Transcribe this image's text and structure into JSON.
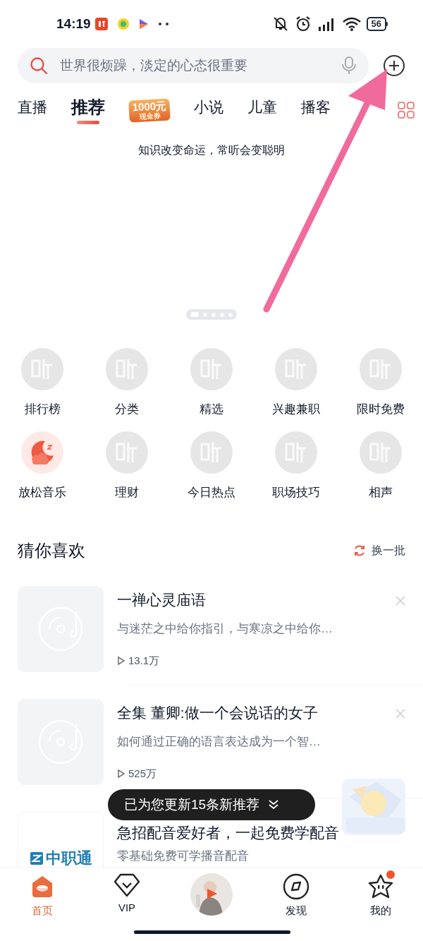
{
  "status_bar": {
    "time": "14:19",
    "battery": "56"
  },
  "search": {
    "placeholder": "世界很烦躁，淡定的心态很重要"
  },
  "tabs": [
    {
      "kind": "text",
      "label": "直播",
      "selected": false
    },
    {
      "kind": "text",
      "label": "推荐",
      "selected": true
    },
    {
      "kind": "coupon",
      "label": "1000元",
      "sublabel": "现金券",
      "selected": false
    },
    {
      "kind": "text",
      "label": "小说",
      "selected": false
    },
    {
      "kind": "text",
      "label": "儿童",
      "selected": false
    },
    {
      "kind": "text",
      "label": "播客",
      "selected": false
    }
  ],
  "banner": {
    "slogan": "知识改变命运，常听会变聪明",
    "dots": [
      {
        "selected": true
      },
      {
        "selected": false
      },
      {
        "selected": false
      },
      {
        "selected": false
      },
      {
        "selected": false
      }
    ]
  },
  "shortcuts": [
    {
      "kind": "placeholder",
      "label": "排行榜"
    },
    {
      "kind": "placeholder",
      "label": "分类"
    },
    {
      "kind": "placeholder",
      "label": "精选"
    },
    {
      "kind": "placeholder",
      "label": "兴趣兼职"
    },
    {
      "kind": "placeholder",
      "label": "限时免费"
    },
    {
      "kind": "moon",
      "label": "放松音乐"
    },
    {
      "kind": "placeholder",
      "label": "理财"
    },
    {
      "kind": "placeholder",
      "label": "今日热点"
    },
    {
      "kind": "placeholder",
      "label": "职场技巧"
    },
    {
      "kind": "placeholder",
      "label": "相声"
    }
  ],
  "recommend": {
    "title": "猜你喜欢",
    "refresh": "换一批",
    "items": [
      {
        "kind": "album",
        "title": "一禅心灵庙语",
        "subtitle": "与迷茫之中给你指引，与寒凉之中给你…",
        "plays": "13.1万"
      },
      {
        "kind": "album",
        "title": "全集 董卿:做一个会说话的女子",
        "subtitle": "如何通过正确的语言表达成为一个智…",
        "plays": "525万"
      },
      {
        "kind": "ad",
        "logo": "中职通",
        "title": "急招配音爱好者，一起免费学配音",
        "subtitle": "零基础免费可学播音配音"
      }
    ]
  },
  "toast": "已为您更新15条新推荐",
  "bottom_nav": [
    {
      "kind": "home",
      "label": "首页",
      "selected": true,
      "badge": false
    },
    {
      "kind": "vip",
      "label": "VIP",
      "selected": false,
      "badge": false
    },
    {
      "kind": "player"
    },
    {
      "kind": "discover",
      "label": "发现",
      "selected": false,
      "badge": false
    },
    {
      "kind": "me",
      "label": "我的",
      "selected": false,
      "badge": true
    }
  ]
}
